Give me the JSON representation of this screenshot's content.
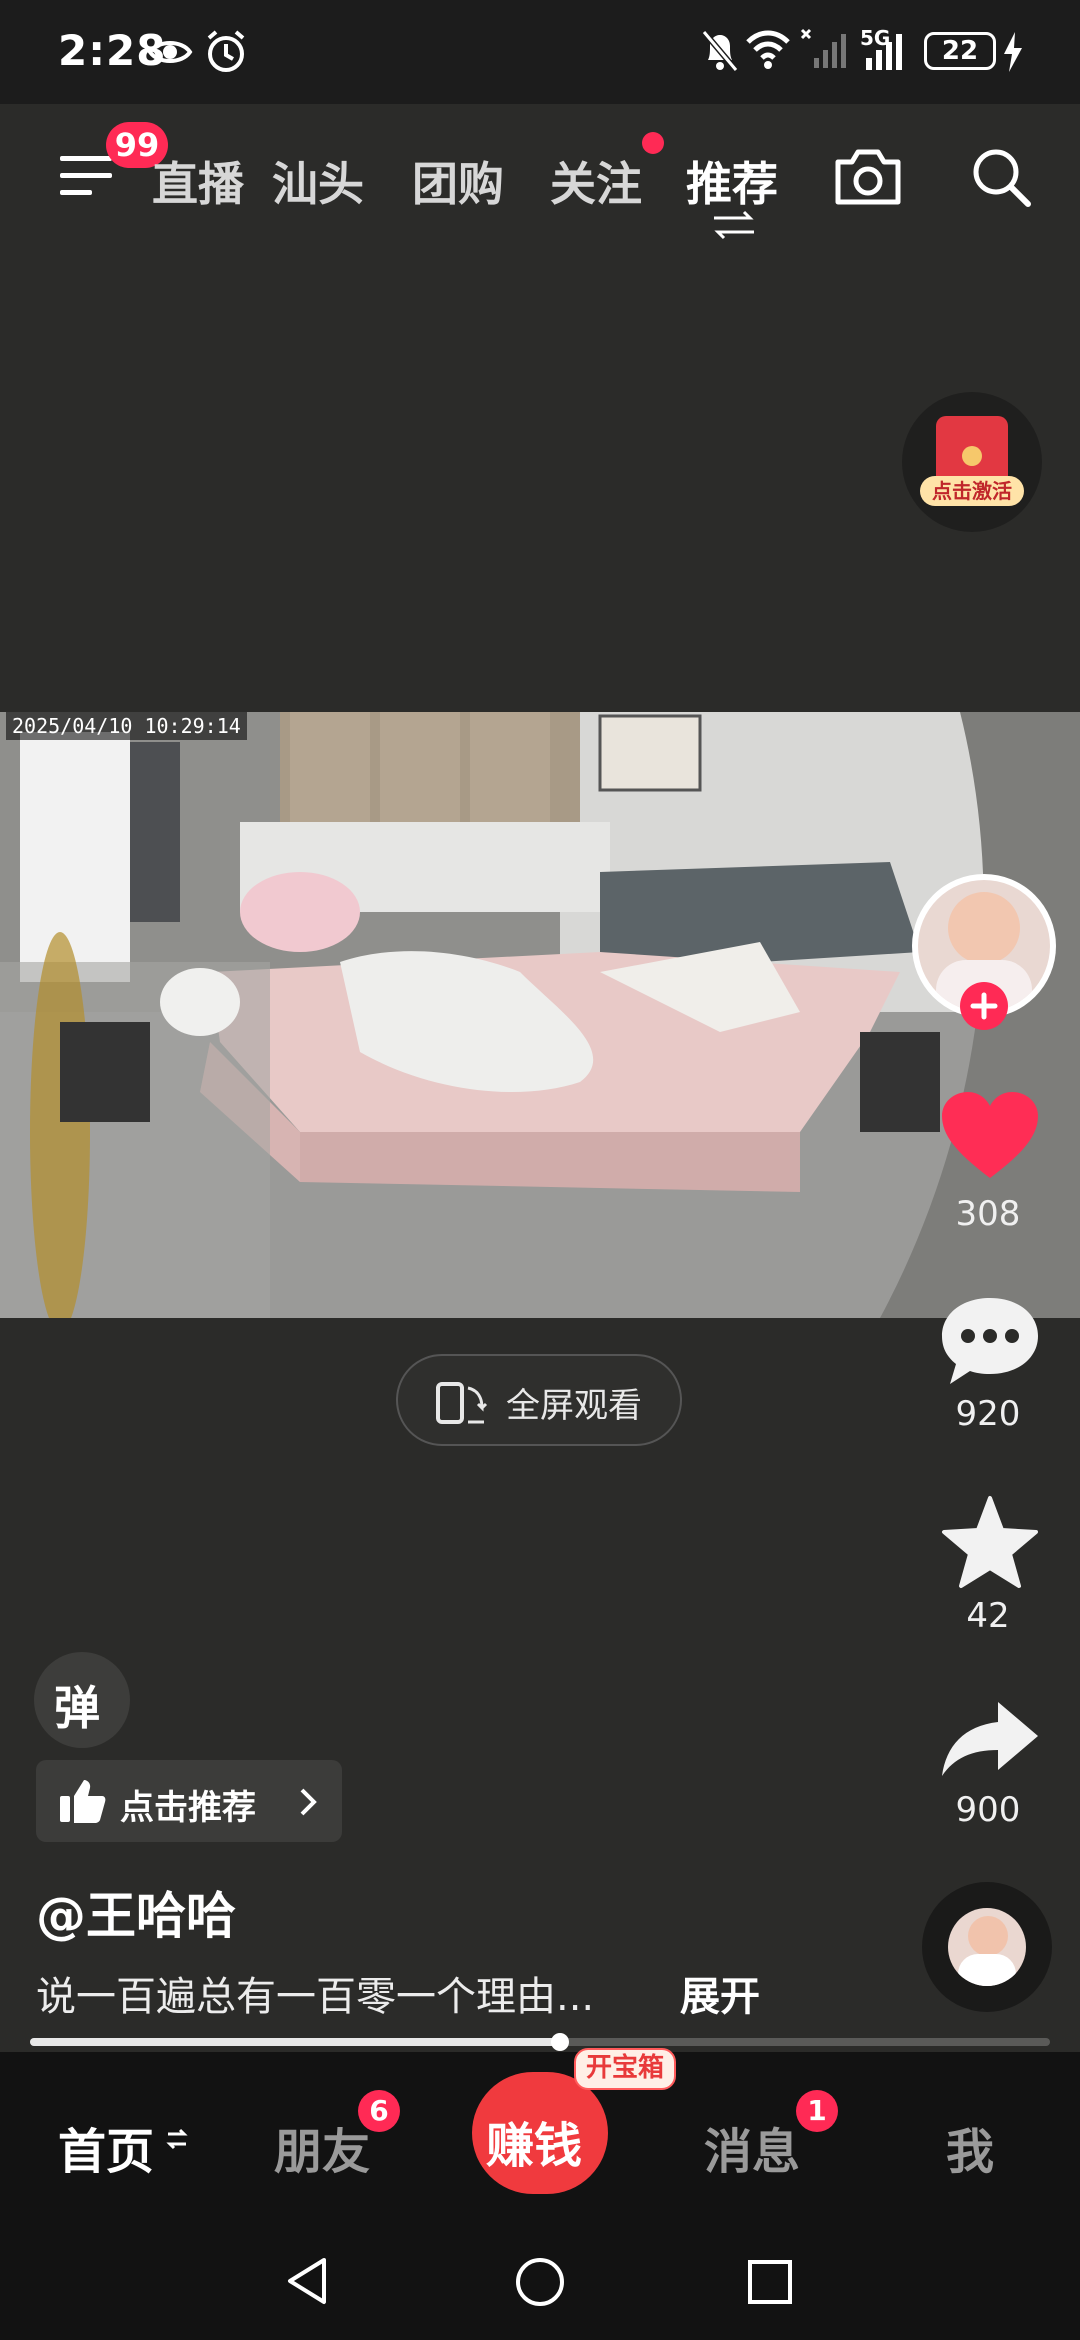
{
  "status_bar": {
    "time": "2:28",
    "network": "5G",
    "battery": "22"
  },
  "top_nav": {
    "menu_badge": "99",
    "tabs": [
      {
        "label": "直播"
      },
      {
        "label": "汕头"
      },
      {
        "label": "团购"
      },
      {
        "label": "关注"
      },
      {
        "label": "推荐"
      }
    ],
    "active_tab": "推荐"
  },
  "video": {
    "timestamp": "2025/04/10 10:29:14",
    "activate_label": "点击激活"
  },
  "fullscreen": {
    "label": "全屏观看"
  },
  "right_rail": {
    "likes": "308",
    "comments": "920",
    "favorites": "42",
    "shares": "900"
  },
  "bottom_left": {
    "danmu_label": "弹",
    "recommend_label": "点击推荐",
    "author": "@王哈哈",
    "caption": "说一百遍总有一百零一个理由...",
    "expand_label": "展开"
  },
  "progress": {
    "fraction": 0.52
  },
  "bottom_nav": {
    "home": "首页",
    "friends": "朋友",
    "friends_badge": "6",
    "earn": "赚钱",
    "treasure": "开宝箱",
    "messages": "消息",
    "messages_badge": "1",
    "me": "我"
  },
  "colors": {
    "accent_red": "#ff2a55",
    "earn_red": "#f03a3e",
    "background": "#2b2b29"
  }
}
